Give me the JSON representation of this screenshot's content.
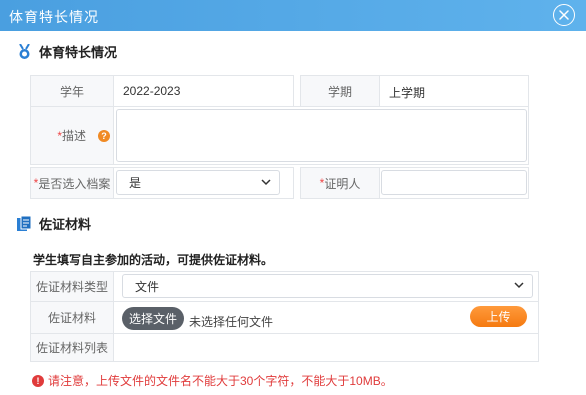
{
  "dialog": {
    "title": "体育特长情况"
  },
  "section1": {
    "title": "体育特长情况",
    "year_label": "学年",
    "year_value": "2022-2023",
    "term_label": "学期",
    "term_value": "上学期",
    "desc_required": "*",
    "desc_label": "描述",
    "archive_required": "*",
    "archive_label": "是否选入档案",
    "archive_value": "是",
    "witness_required": "*",
    "witness_label": "证明人",
    "witness_value": ""
  },
  "section2": {
    "title": "佐证材料",
    "instruction": "学生填写自主参加的活动，可提供佐证材料。",
    "type_label": "佐证材料类型",
    "type_value": "文件",
    "material_label": "佐证材料",
    "choose_button": "选择文件",
    "no_file_text": "未选择任何文件",
    "upload_button": "上传",
    "list_label": "佐证材料列表",
    "warning": "请注意，上传文件的文件名不能大于30个字符，不能大于10MB。"
  },
  "colors": {
    "titlebar": "#4a9fe0",
    "accent_orange": "#f57a10",
    "required_red": "#e44",
    "warning_red": "#e03b3b"
  }
}
